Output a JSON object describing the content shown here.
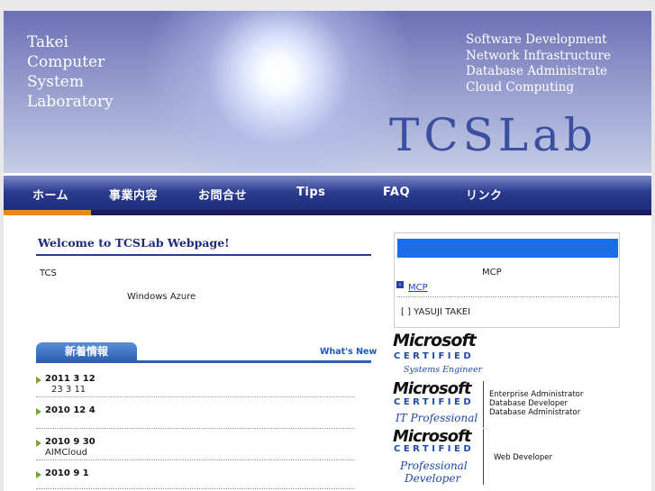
{
  "header": {
    "name_lines": [
      "Takei",
      "Computer",
      "System",
      "Laboratory"
    ],
    "services": [
      "Software Development",
      "Network Infrastructure",
      "Database Administrate",
      "Cloud Computing"
    ],
    "logo": "TCSLab"
  },
  "nav": {
    "items": [
      {
        "label": "ホーム",
        "active": true
      },
      {
        "label": "事業内容"
      },
      {
        "label": "お問合せ"
      },
      {
        "label": "Tips"
      },
      {
        "label": "FAQ"
      },
      {
        "label": "リンク"
      }
    ],
    "active_color": "#e8891e"
  },
  "main": {
    "title": "Welcome to TCSLab Webpage!",
    "intro_line1": "TCS",
    "intro_line2": "Windows Azure",
    "news_tab": "新着情報",
    "whats_new": "What's New",
    "news": [
      {
        "date": "2011  3  12",
        "detail": "23 3 11"
      },
      {
        "date": "2010  12  4",
        "detail": ""
      },
      {
        "date": "2010  9  30",
        "detail": "AIMCloud"
      },
      {
        "date": "2010  9  1",
        "detail": ""
      }
    ]
  },
  "sidebar": {
    "box_label": "MCP",
    "link": "MCP",
    "holder": "[    ] YASUJI TAKEI",
    "certs": [
      {
        "brand": "Microsoft",
        "certified": "CERTIFIED",
        "subtitle": "Systems Engineer",
        "roles": []
      },
      {
        "brand": "Microsoft",
        "certified": "CERTIFIED",
        "subtitle": "IT Professional",
        "roles": [
          "Enterprise Administrator",
          "Database Developer",
          "Database Administrator"
        ]
      },
      {
        "brand": "Microsoft",
        "certified": "CERTIFIED",
        "subtitle_line1": "Professional",
        "subtitle_line2": "Developer",
        "roles": [
          "Web Developer"
        ]
      }
    ]
  }
}
